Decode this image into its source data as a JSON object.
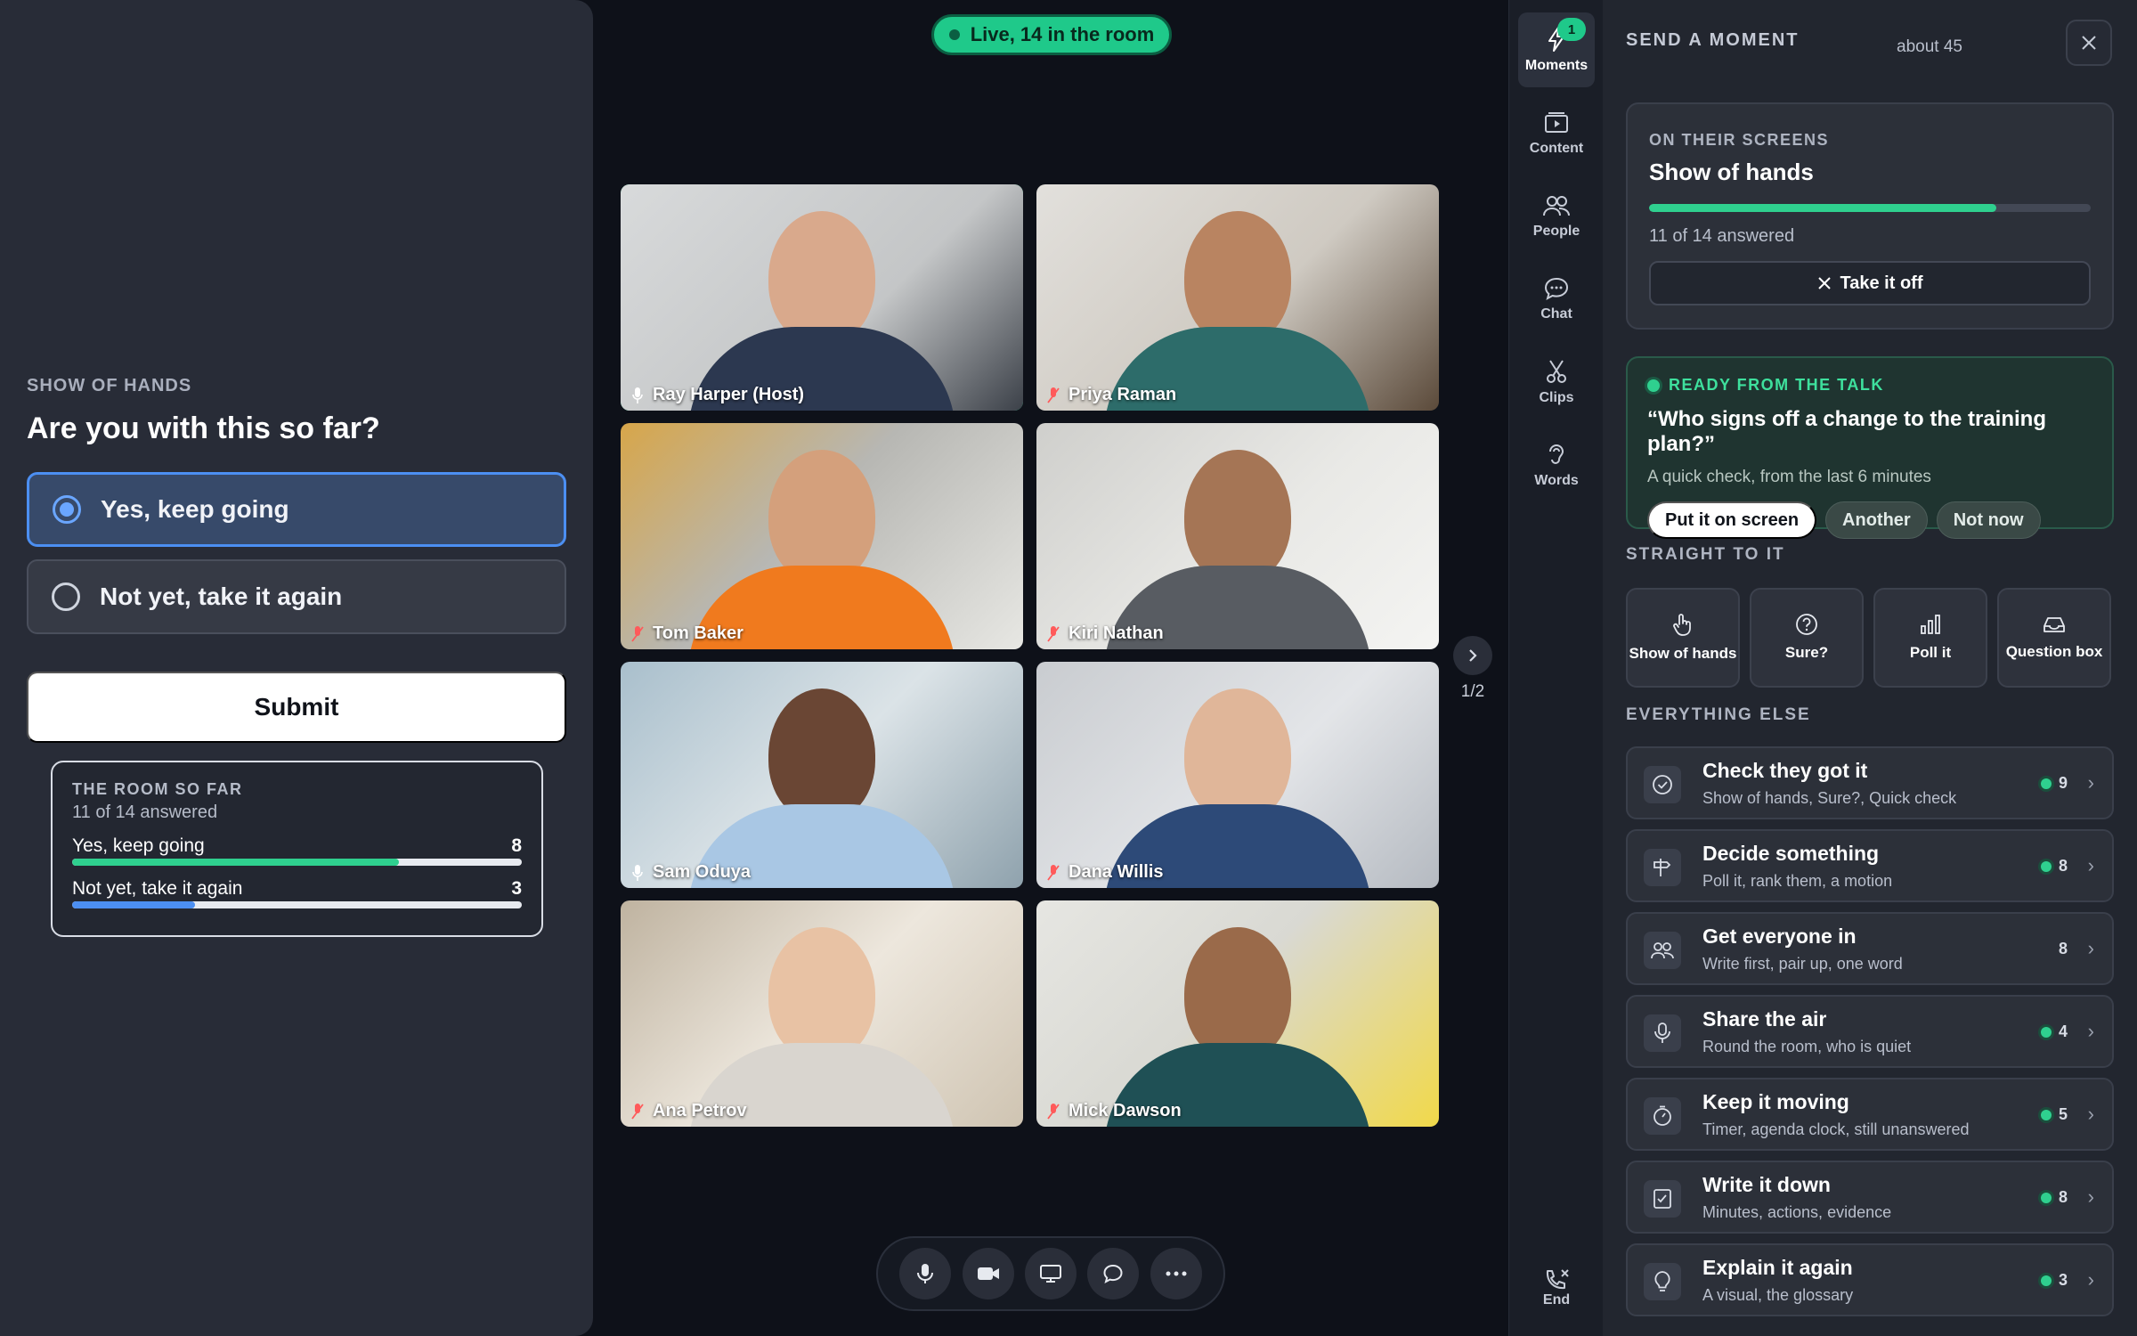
{
  "poll": {
    "kicker": "SHOW OF HANDS",
    "question": "Are you with this so far?",
    "options": [
      {
        "label": "Yes, keep going",
        "selected": true
      },
      {
        "label": "Not yet, take it again",
        "selected": false
      }
    ],
    "submit_label": "Submit",
    "results": {
      "title": "THE ROOM SO FAR",
      "answered": "11 of 14 answered",
      "rows": [
        {
          "label": "Yes, keep going",
          "count": "8",
          "fraction": 0.727,
          "color": "#2fd08f"
        },
        {
          "label": "Not yet, take it again",
          "count": "3",
          "fraction": 0.273,
          "color": "#4c8ff2"
        }
      ]
    }
  },
  "stage": {
    "live_label": "Live, 14 in the room",
    "page_indicator": "1/2",
    "participants": [
      {
        "name": "Ray Harper (Host)",
        "muted": false,
        "host": true
      },
      {
        "name": "Priya Raman",
        "muted": true,
        "host": false
      },
      {
        "name": "Tom Baker",
        "muted": true,
        "host": false
      },
      {
        "name": "Kiri Nathan",
        "muted": true,
        "host": false
      },
      {
        "name": "Sam Oduya",
        "muted": false,
        "host": false
      },
      {
        "name": "Dana Willis",
        "muted": true,
        "host": false
      },
      {
        "name": "Ana Petrov",
        "muted": true,
        "host": false
      },
      {
        "name": "Mick Dawson",
        "muted": true,
        "host": false
      }
    ],
    "controls": [
      "mic-icon",
      "camera-icon",
      "screen-share-icon",
      "chat-icon",
      "more-icon"
    ]
  },
  "rail": {
    "items": [
      {
        "label": "Moments",
        "icon": "bolt-icon",
        "badge": "1",
        "active": true
      },
      {
        "label": "Content",
        "icon": "play-screen-icon"
      },
      {
        "label": "People",
        "icon": "people-icon"
      },
      {
        "label": "Chat",
        "icon": "speech-bubble-icon"
      },
      {
        "label": "Clips",
        "icon": "scissors-icon"
      },
      {
        "label": "Words",
        "icon": "ear-icon"
      }
    ],
    "end_label": "End"
  },
  "moments": {
    "title": "SEND A MOMENT",
    "about": "about 45",
    "on_screen": {
      "kicker": "ON THEIR SCREENS",
      "heading": "Show of hands",
      "progress": 0.786,
      "answered": "11 of 14 answered",
      "take_off_label": "Take it off"
    },
    "ready": {
      "kicker": "READY FROM THE TALK",
      "quote": "“Who signs off a change to the training plan?”",
      "sub": "A quick check, from the last 6 minutes",
      "actions": {
        "primary": "Put it on screen",
        "another": "Another",
        "not_now": "Not now"
      }
    },
    "straight_label": "STRAIGHT TO IT",
    "quick": [
      {
        "label": "Show of hands",
        "icon": "hand-icon"
      },
      {
        "label": "Sure?",
        "icon": "question-circle-icon"
      },
      {
        "label": "Poll it",
        "icon": "bar-chart-icon"
      },
      {
        "label": "Question box",
        "icon": "inbox-icon"
      }
    ],
    "else_label": "EVERYTHING ELSE",
    "list": [
      {
        "title": "Check they got it",
        "sub": "Show of hands, Sure?, Quick check",
        "count": "9",
        "dot": true,
        "icon": "check-badge-icon"
      },
      {
        "title": "Decide something",
        "sub": "Poll it, rank them, a motion",
        "count": "8",
        "dot": true,
        "icon": "signpost-icon"
      },
      {
        "title": "Get everyone in",
        "sub": "Write first, pair up, one word",
        "count": "8",
        "dot": false,
        "icon": "group-icon"
      },
      {
        "title": "Share the air",
        "sub": "Round the room, who is quiet",
        "count": "4",
        "dot": true,
        "icon": "microphone-icon"
      },
      {
        "title": "Keep it moving",
        "sub": "Timer, agenda clock, still unanswered",
        "count": "5",
        "dot": true,
        "icon": "stopwatch-icon"
      },
      {
        "title": "Write it down",
        "sub": "Minutes, actions, evidence",
        "count": "8",
        "dot": true,
        "icon": "checklist-icon"
      },
      {
        "title": "Explain it again",
        "sub": "A visual, the glossary",
        "count": "3",
        "dot": true,
        "icon": "lightbulb-icon"
      }
    ]
  }
}
